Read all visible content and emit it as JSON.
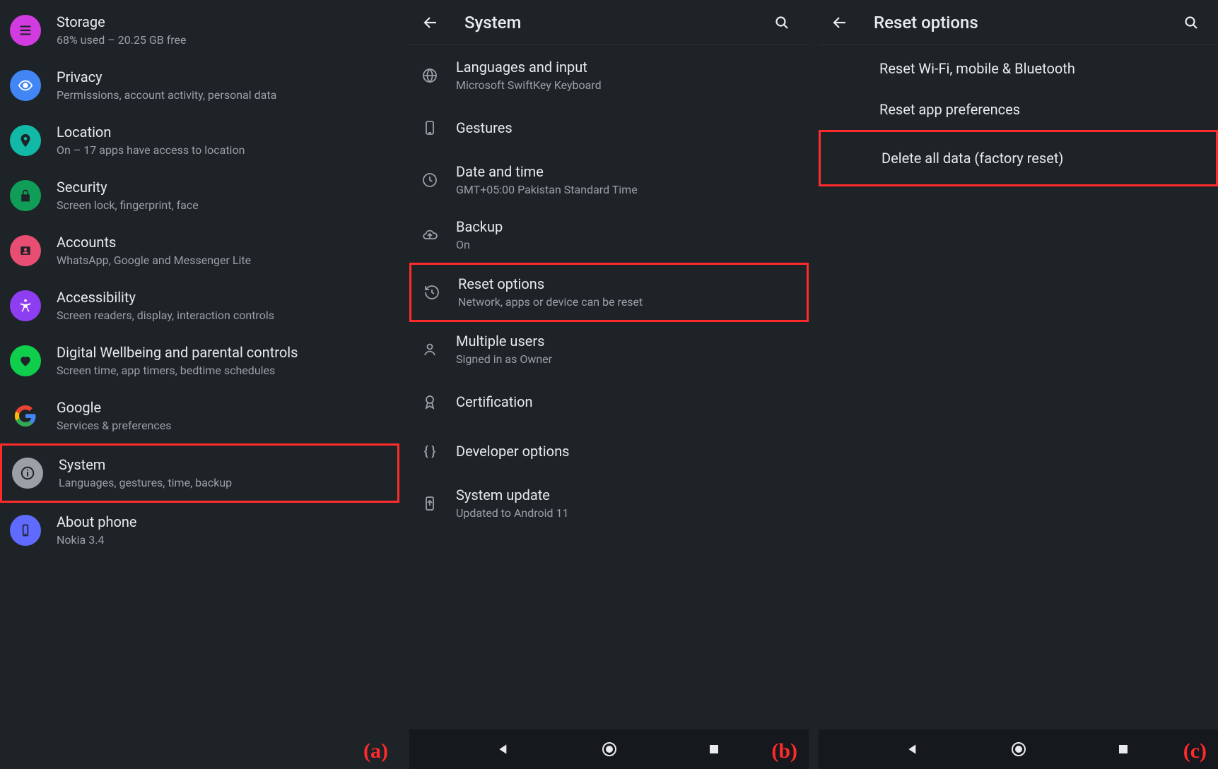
{
  "panelA": {
    "tag": "(a)",
    "items": [
      {
        "key": "storage",
        "title": "Storage",
        "sub": "68% used – 20.25 GB free",
        "iconColor": "#d23be0",
        "icon": "storage-icon"
      },
      {
        "key": "privacy",
        "title": "Privacy",
        "sub": "Permissions, account activity, personal data",
        "iconColor": "#4285f4",
        "icon": "eye-icon"
      },
      {
        "key": "location",
        "title": "Location",
        "sub": "On – 17 apps have access to location",
        "iconColor": "#12b9a6",
        "icon": "location-pin-icon"
      },
      {
        "key": "security",
        "title": "Security",
        "sub": "Screen lock, fingerprint, face",
        "iconColor": "#0f9d58",
        "icon": "lock-icon"
      },
      {
        "key": "accounts",
        "title": "Accounts",
        "sub": "WhatsApp, Google and Messenger Lite",
        "iconColor": "#e84d72",
        "icon": "accounts-icon"
      },
      {
        "key": "accessibility",
        "title": "Accessibility",
        "sub": "Screen readers, display, interaction controls",
        "iconColor": "#8c3ef0",
        "icon": "accessibility-icon"
      },
      {
        "key": "wellbeing",
        "title": "Digital Wellbeing and parental controls",
        "sub": "Screen time, app timers, bedtime schedules",
        "iconColor": "#0fce4c",
        "icon": "heart-icon"
      },
      {
        "key": "google",
        "title": "Google",
        "sub": "Services & preferences",
        "iconColor": "#1e2328",
        "icon": "google-icon"
      },
      {
        "key": "system",
        "title": "System",
        "sub": "Languages, gestures, time, backup",
        "iconColor": "#9aa0a6",
        "icon": "info-icon",
        "highlight": true
      },
      {
        "key": "about",
        "title": "About phone",
        "sub": "Nokia 3.4",
        "iconColor": "#5f6bff",
        "icon": "phone-icon"
      }
    ]
  },
  "panelB": {
    "tag": "(b)",
    "header": "System",
    "items": [
      {
        "key": "languages",
        "title": "Languages and input",
        "sub": "Microsoft SwiftKey Keyboard",
        "icon": "globe-icon"
      },
      {
        "key": "gestures",
        "title": "Gestures",
        "sub": "",
        "icon": "gesture-icon"
      },
      {
        "key": "datetime",
        "title": "Date and time",
        "sub": "GMT+05:00 Pakistan Standard Time",
        "icon": "clock-icon"
      },
      {
        "key": "backup",
        "title": "Backup",
        "sub": "On",
        "icon": "cloud-icon"
      },
      {
        "key": "reset",
        "title": "Reset options",
        "sub": "Network, apps or device can be reset",
        "icon": "restore-icon",
        "highlight": true
      },
      {
        "key": "multiusers",
        "title": "Multiple users",
        "sub": "Signed in as Owner",
        "icon": "person-icon"
      },
      {
        "key": "certification",
        "title": "Certification",
        "sub": "",
        "icon": "rosette-icon"
      },
      {
        "key": "devopts",
        "title": "Developer options",
        "sub": "",
        "icon": "braces-icon"
      },
      {
        "key": "sysupdate",
        "title": "System update",
        "sub": "Updated to Android 11",
        "icon": "update-icon"
      }
    ]
  },
  "panelC": {
    "tag": "(c)",
    "header": "Reset options",
    "items": [
      {
        "key": "resetnet",
        "title": "Reset Wi-Fi, mobile & Bluetooth"
      },
      {
        "key": "resetapps",
        "title": "Reset app preferences"
      },
      {
        "key": "factory",
        "title": "Delete all data (factory reset)",
        "highlight": true
      }
    ]
  }
}
